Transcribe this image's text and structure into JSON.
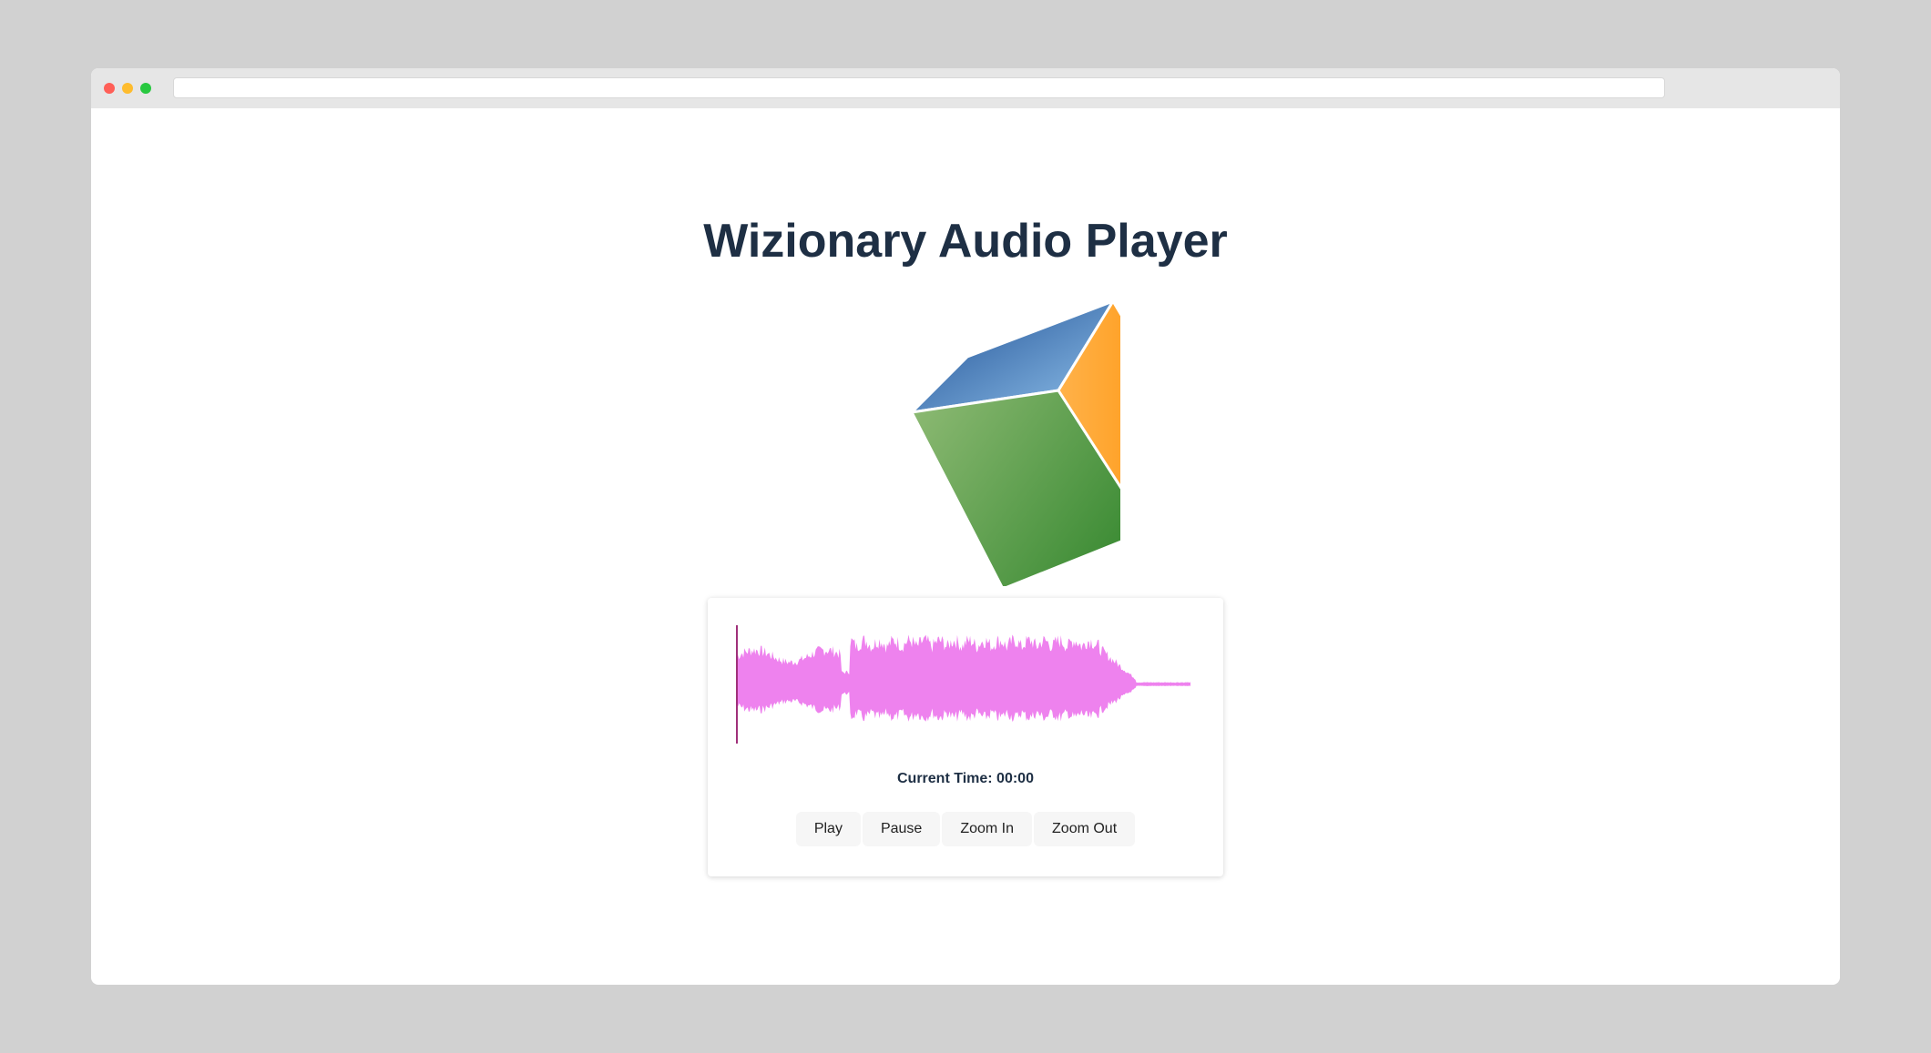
{
  "browser": {
    "url": ""
  },
  "page": {
    "title": "Wizionary Audio Player"
  },
  "logo": {
    "icon": "cube-logo-icon",
    "face_colors": {
      "top": "#2f6db3",
      "left": "#6aa85a",
      "right": "#ff9a1f"
    }
  },
  "player": {
    "current_time_label": "Current Time: 00:00",
    "waveform_color": "#ee82ee",
    "cursor_color": "#a0307a",
    "playback_progress": 0,
    "buttons": {
      "play": "Play",
      "pause": "Pause",
      "zoom_in": "Zoom In",
      "zoom_out": "Zoom Out"
    }
  },
  "colors": {
    "title": "#1e2f44",
    "background": "#d1d1d1",
    "window": "#ffffff",
    "traffic_red": "#ff5f57",
    "traffic_yellow": "#febc2e",
    "traffic_green": "#28c840"
  }
}
